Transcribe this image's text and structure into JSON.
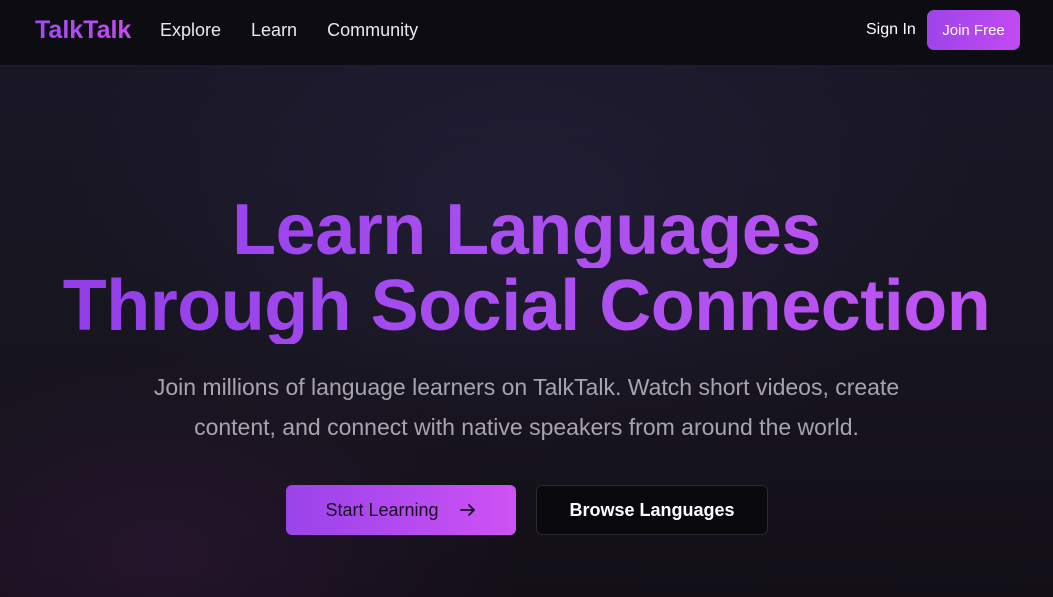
{
  "header": {
    "logo": "TalkTalk",
    "nav": [
      {
        "label": "Explore"
      },
      {
        "label": "Learn"
      },
      {
        "label": "Community"
      }
    ],
    "sign_in": "Sign In",
    "join_free": "Join Free"
  },
  "hero": {
    "title_line1": "Learn Languages",
    "title_line2": "Through Social Connection",
    "subtitle_line1": "Join millions of language learners on TalkTalk. Watch short videos, create",
    "subtitle_line2": "content, and connect with native speakers from around the world.",
    "primary_cta": "Start Learning",
    "primary_cta_icon": "arrow-right-icon",
    "secondary_cta": "Browse Languages"
  },
  "colors": {
    "accent_start": "#9d44ea",
    "accent_end": "#c24af0",
    "background": "#14121c",
    "header_bg": "#0d0c12"
  }
}
